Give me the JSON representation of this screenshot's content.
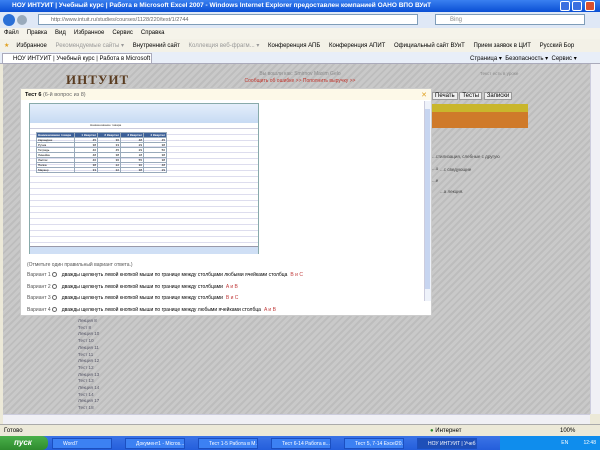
{
  "window": {
    "title": "НОУ ИНТУИТ | Учебный курс | Работа в Microsoft Excel 2007 - Windows Internet Explorer предоставлен компанией ОАНО ВПО ВУиТ"
  },
  "address": {
    "url": "http://www.intuit.ru/studies/courses/1128/220/test/1/2744",
    "search_placeholder": "Bing"
  },
  "menu": [
    "Файл",
    "Правка",
    "Вид",
    "Избранное",
    "Сервис",
    "Справка"
  ],
  "favorites": [
    "Избранное",
    "Рекомендуемые сайты ▾",
    "Внутренний сайт",
    "Коллекция веб-фрагм... ▾",
    "Конференция АПБ",
    "Конференция АПИТ",
    "Официальный сайт ВУиТ",
    "Прием заявок в ЦИТ",
    "Русский Бор"
  ],
  "tab": {
    "label": "НОУ ИНТУИТ | Учебный курс | Работа в Microsoft E..."
  },
  "commandbar": [
    "Страница ▾",
    "Безопасность ▾",
    "Сервис ▾"
  ],
  "page": {
    "logo": "ИНТУИТ",
    "login_line": "Вы вошли как: Smirnov Maxim Gelo",
    "links": "Сообщить об ошибке >> Пополнить выручку >>",
    "right_top": "Текст есть в уроке",
    "right_buttons": [
      "Печать",
      "Тесты",
      "Записки"
    ],
    "side_texts": [
      "...стилизация, слебные с другую",
      "...о",
      "...с сведующие",
      "...е",
      "...а лекция."
    ],
    "nav": [
      "Лекция 8",
      "Тест 8",
      "Лекция 10",
      "Тест 10",
      "Лекция 11",
      "Тест 11",
      "Лекция 12",
      "Тест 12",
      "Лекция 13",
      "Тест 13",
      "Лекция 14",
      "Тест 14"
    ],
    "nav_bottom": [
      "Лекция 17",
      "Тест 18"
    ]
  },
  "dialog": {
    "title": "Тест 6",
    "subtitle": "(6-й вопрос из 8)",
    "question": "(Отметьте один правильный вариант ответа.)",
    "options": [
      {
        "label": "Вариант 1",
        "text": "дважды щелкнуть левой кнопкой мыши по границе между столбцами любыми ячейками столбца",
        "letters": "B и C"
      },
      {
        "label": "Вариант 2",
        "text": "дважды щелкнуть левой кнопкой мыши по границе между столбцами",
        "letters": "A и B"
      },
      {
        "label": "Вариант 3",
        "text": "дважды щелкнуть левой кнопкой мыши по границе между столбцами",
        "letters": "B и C"
      },
      {
        "label": "Вариант 4",
        "text": "дважды щелкнуть левой кнопкой мыши по границе между любыми ячейками столбца",
        "letters": "A и B"
      }
    ]
  },
  "excel": {
    "formula": "Наименование товара",
    "headers": [
      "Наименование товара",
      "1 Квартал",
      "2 Квартал",
      "3 Квартал",
      "4 Квартал"
    ],
    "rows": [
      [
        "Карандаш",
        "45",
        "36",
        "48",
        "45"
      ],
      [
        "Ручка",
        "38",
        "33",
        "29",
        "38"
      ],
      [
        "Тетрадь",
        "40",
        "45",
        "29",
        "50"
      ],
      [
        "Линейка",
        "48",
        "38",
        "18",
        "38"
      ],
      [
        "Ластик",
        "46",
        "36",
        "55",
        "38"
      ],
      [
        "Папка",
        "38",
        "22",
        "30",
        "48"
      ],
      [
        "Маркер",
        "33",
        "22",
        "38",
        "29"
      ]
    ]
  },
  "status": {
    "left": "Готово",
    "zone": "Интернет",
    "zoom": "100%"
  },
  "taskbar": {
    "start": "пуск",
    "tasks": [
      "Word7",
      "Документ1 - Micros...",
      "Тест 1-5 Работа в M...",
      "Тест 6-14 Работа в...",
      "Тест 5, 7-14 Excel20...",
      "НОУ ИНТУИТ | Учеб..."
    ],
    "lang": "EN",
    "clock": "12:48"
  }
}
